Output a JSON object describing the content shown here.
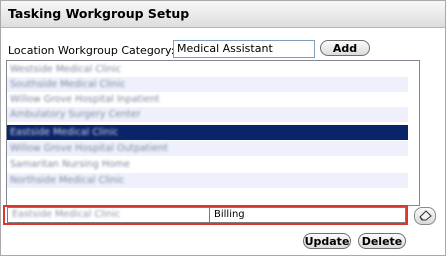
{
  "window": {
    "title": "Tasking Workgroup Setup"
  },
  "category": {
    "label": "Location Workgroup Category:",
    "value": "Medical Assistant",
    "add_label": "Add"
  },
  "locations": [
    "Westside Medical Clinic",
    "Southside Medical Clinic",
    "Willow Grove Hospital Inpatient",
    "Ambulatory Surgery Center",
    "Eastside Medical Clinic",
    "Willow Grove Hospital Outpatient",
    "Samaritan Nursing Home",
    "Northside Medical Clinic"
  ],
  "selected_index": 4,
  "edit": {
    "location": "Eastside Medical Clinic",
    "workgroup": "Billing"
  },
  "icons": {
    "clear": "eraser-icon"
  },
  "actions": {
    "update_label": "Update",
    "delete_label": "Delete"
  },
  "colors": {
    "selection": "#0a246a",
    "highlight_outline": "#d9372f"
  }
}
